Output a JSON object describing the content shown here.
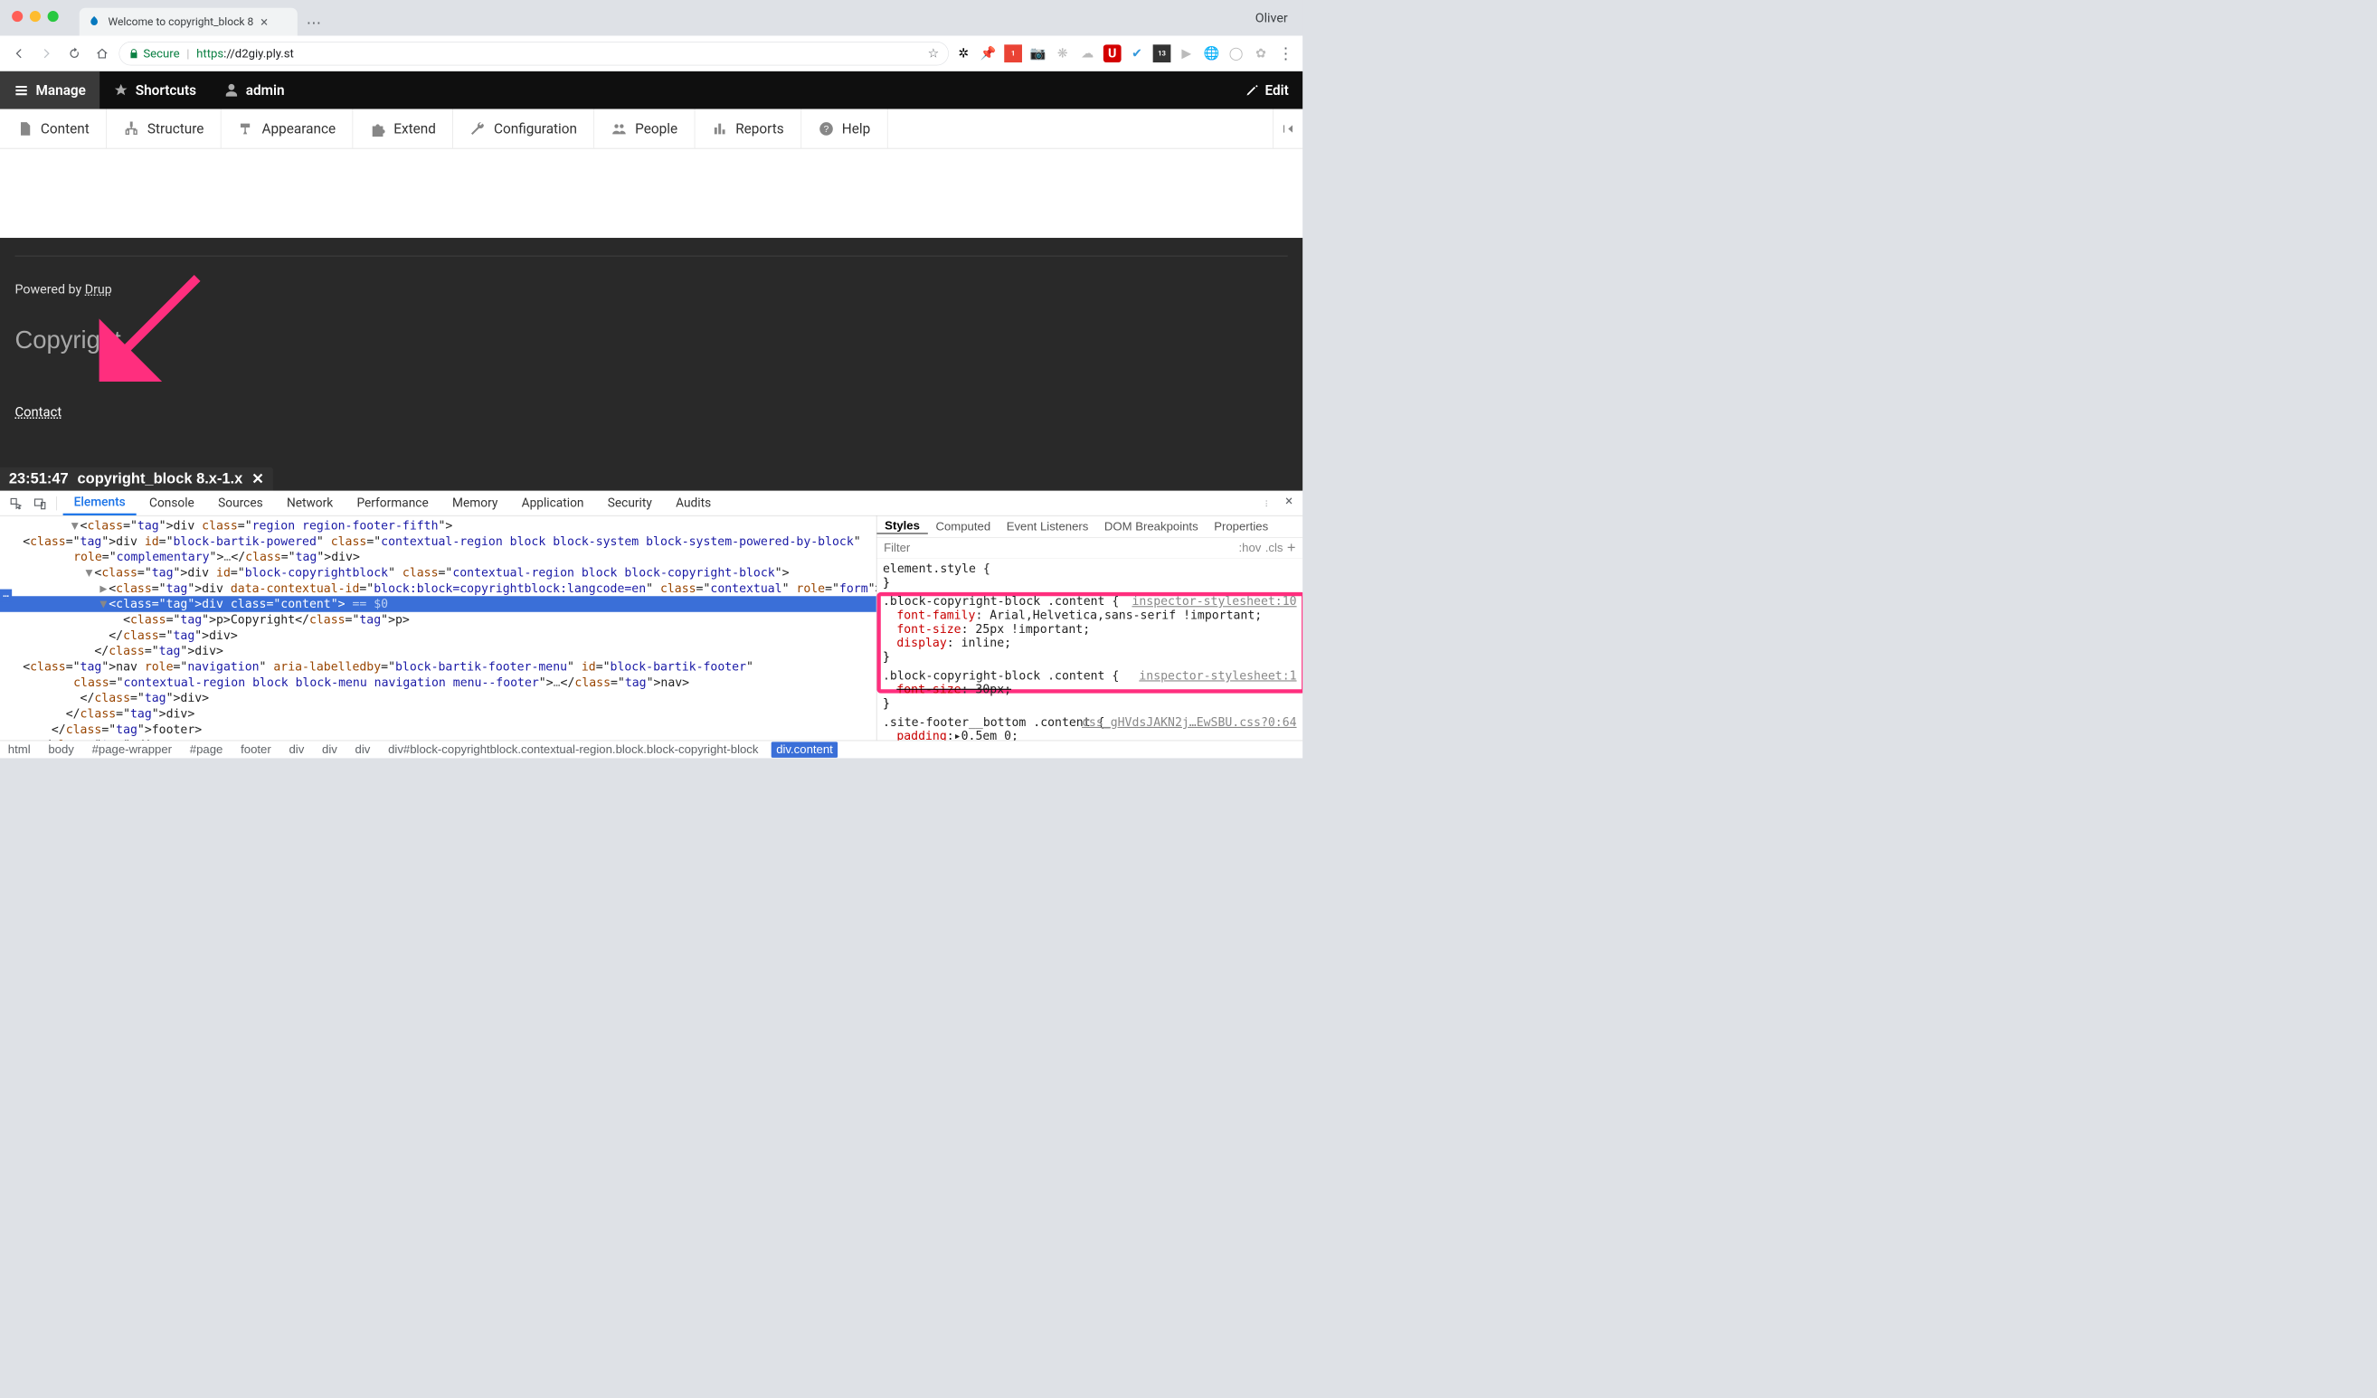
{
  "chrome": {
    "profile": "Oliver",
    "tab_title": "Welcome to copyright_block 8",
    "secure_label": "Secure",
    "url_proto": "https",
    "url_rest": "://d2giy.ply.st",
    "ext_icons": [
      "settings",
      "pin",
      "translate-1",
      "camera",
      "norton",
      "cloud",
      "ublock",
      "pocket",
      "img13",
      "play",
      "world",
      "circle",
      "flower",
      "menu"
    ]
  },
  "toolbar": {
    "manage": "Manage",
    "shortcuts": "Shortcuts",
    "admin": "admin",
    "edit": "Edit"
  },
  "admin_menu": {
    "content": "Content",
    "structure": "Structure",
    "appearance": "Appearance",
    "extend": "Extend",
    "configuration": "Configuration",
    "people": "People",
    "reports": "Reports",
    "help": "Help"
  },
  "footer": {
    "powered_by_prefix": "Powered by ",
    "powered_by_link": "Drup",
    "copyright_text": "Copyright",
    "contact": "Contact"
  },
  "status_bar": {
    "time": "23:51:47",
    "label": "copyright_block 8.x-1.x"
  },
  "devtools": {
    "tabs": [
      "Elements",
      "Console",
      "Sources",
      "Network",
      "Performance",
      "Memory",
      "Application",
      "Security",
      "Audits"
    ],
    "active_tab": "Elements",
    "side_tabs": [
      "Styles",
      "Computed",
      "Event Listeners",
      "DOM Breakpoints",
      "Properties"
    ],
    "side_active": "Styles",
    "filter_placeholder": "Filter",
    "hov": ":hov",
    "cls": ".cls",
    "dom_lines": {
      "l1a": "▼",
      "l1": "<div class=\"region region-footer-fifth\">",
      "l2a": "▶",
      "l2": "<div id=\"block-bartik-powered\" class=\"contextual-region block block-system block-system-powered-by-block\" role=\"complementary\">…</div>",
      "l3a": "▼",
      "l3": "<div id=\"block-copyrightblock\" class=\"contextual-region block block-copyright-block\">",
      "l4a": "▶",
      "l4": "<div data-contextual-id=\"block:block=copyrightblock:langcode=en\" class=\"contextual\" role=\"form\">…</div>",
      "l5a": "▼",
      "l5": "<div class=\"content\">",
      "l5suffix": " == $0",
      "l6": "<p>Copyright</p>",
      "l7": "</div>",
      "l8": "</div>",
      "l9a": "▶",
      "l9": "<nav role=\"navigation\" aria-labelledby=\"block-bartik-footer-menu\" id=\"block-bartik-footer\" class=\"contextual-region block block-menu navigation menu--footer\">…</nav>",
      "l10": "</div>",
      "l11": "</div>",
      "l12": "</footer>",
      "l13": "</div>"
    },
    "styles": {
      "rule0": {
        "sel": "element.style {",
        "close": "}"
      },
      "rule1": {
        "sel": ".block-copyright-block .content {",
        "src": "inspector-stylesheet:10",
        "p1": {
          "name": "font-family",
          "val": ": Arial,Helvetica,sans-serif !important;"
        },
        "p2": {
          "name": "font-size",
          "val": ": 25px !important;"
        },
        "p3": {
          "name": "display",
          "val": ": inline;"
        },
        "close": "}"
      },
      "rule2": {
        "sel": ".block-copyright-block .content {",
        "src": "inspector-stylesheet:1",
        "p1": {
          "name": "font-size",
          "val": ": 30px;"
        },
        "close": "}"
      },
      "rule3": {
        "sel": ".site-footer__bottom .content {",
        "src": "css_gHVdsJAKN2j…EwSBU.css?0:64",
        "p1": {
          "name": "padding",
          "val": ":▸0.5em 0;"
        }
      }
    },
    "path": [
      "html",
      "body",
      "#page-wrapper",
      "#page",
      "footer",
      "div",
      "div",
      "div",
      "div#block-copyrightblock.contextual-region.block.block-copyright-block",
      "div.content"
    ]
  }
}
